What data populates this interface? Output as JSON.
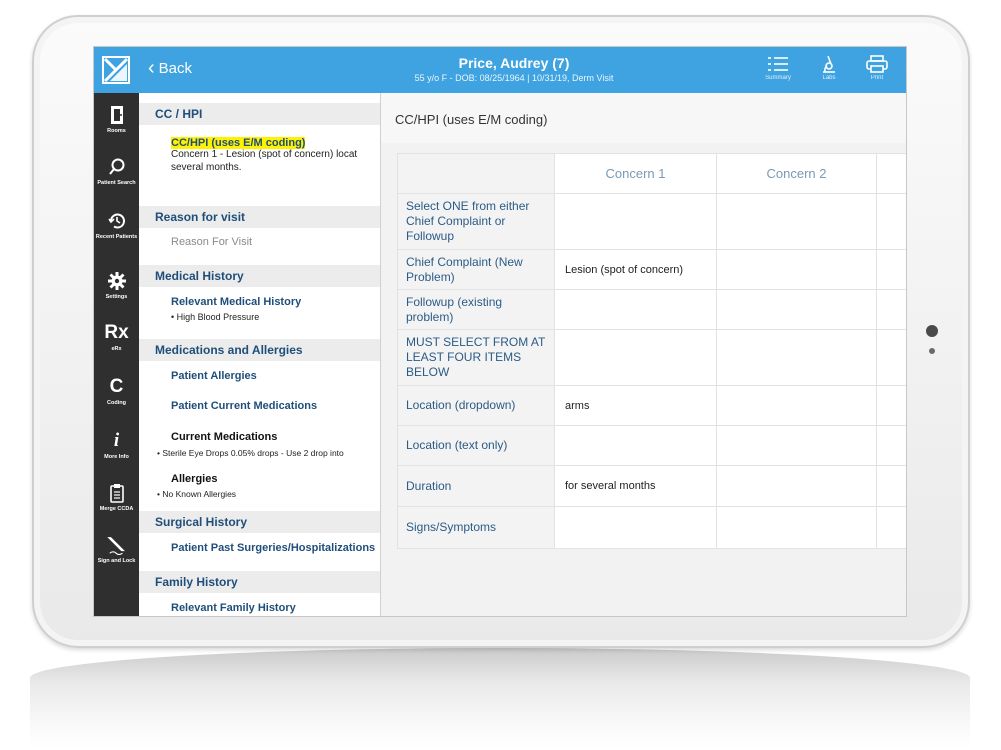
{
  "header": {
    "back_label": "Back",
    "patient_name": "Price, Audrey (7)",
    "patient_details": "55 y/o F - DOB: 08/25/1964 | 10/31/19, Derm Visit",
    "tools": [
      {
        "label": "Summary",
        "icon": "list-icon"
      },
      {
        "label": "Labs",
        "icon": "microscope-icon"
      },
      {
        "label": "Print",
        "icon": "printer-icon"
      }
    ],
    "accent_color": "#3ea3e0"
  },
  "sidebar": {
    "items": [
      {
        "label": "Rooms",
        "icon": "door-icon"
      },
      {
        "label": "Patient Search",
        "icon": "search-icon"
      },
      {
        "label": "Recent Patients",
        "icon": "history-icon"
      },
      {
        "label": "Settings",
        "icon": "gear-icon"
      },
      {
        "label": "eRx",
        "icon": "rx-icon",
        "glyph": "Rx"
      },
      {
        "label": "Coding",
        "icon": "coding-icon",
        "glyph": "C"
      },
      {
        "label": "More Info",
        "icon": "info-icon",
        "glyph": "i"
      },
      {
        "label": "Merge CCDA",
        "icon": "clipboard-icon"
      },
      {
        "label": "Sign and Lock",
        "icon": "pen-icon"
      }
    ]
  },
  "chart_list": {
    "cc_hpi": {
      "heading": "CC / HPI",
      "highlight": "CC/HPI (uses E/M coding)",
      "line1": "Concern 1 - Lesion (spot of concern) locat",
      "line2": "several months."
    },
    "reason": {
      "heading": "Reason for visit",
      "placeholder": "Reason For Visit"
    },
    "medical_history": {
      "heading": "Medical History",
      "link": "Relevant Medical History",
      "item": "• High Blood Pressure"
    },
    "meds": {
      "heading": "Medications and Allergies",
      "link_allergies": "Patient Allergies",
      "link_meds": "Patient Current Medications",
      "current_title": "Current Medications",
      "current_item": "• Sterile Eye Drops 0.05% drops - Use 2 drop into",
      "allergies_title": "Allergies",
      "allergies_item": "• No Known Allergies"
    },
    "surgical": {
      "heading": "Surgical History",
      "link": "Patient Past Surgeries/Hospitalizations"
    },
    "family": {
      "heading": "Family History",
      "link": "Relevant Family History"
    }
  },
  "detail": {
    "title": "CC/HPI (uses E/M coding)",
    "columns": [
      "Concern 1",
      "Concern 2"
    ],
    "rows": [
      {
        "label": "Select ONE from either Chief Complaint or Followup",
        "c1": "",
        "c2": ""
      },
      {
        "label": "Chief Complaint (New Problem)",
        "c1": "Lesion (spot of concern)",
        "c2": ""
      },
      {
        "label": "Followup (existing problem)",
        "c1": "",
        "c2": ""
      },
      {
        "label": "MUST SELECT FROM AT LEAST FOUR ITEMS BELOW",
        "c1": "",
        "c2": ""
      },
      {
        "label": "Location (dropdown)",
        "c1": "arms",
        "c2": ""
      },
      {
        "label": "Location (text only)",
        "c1": "",
        "c2": ""
      },
      {
        "label": "Duration",
        "c1": "for several months",
        "c2": ""
      },
      {
        "label": "Signs/Symptoms",
        "c1": "",
        "c2": ""
      }
    ]
  }
}
